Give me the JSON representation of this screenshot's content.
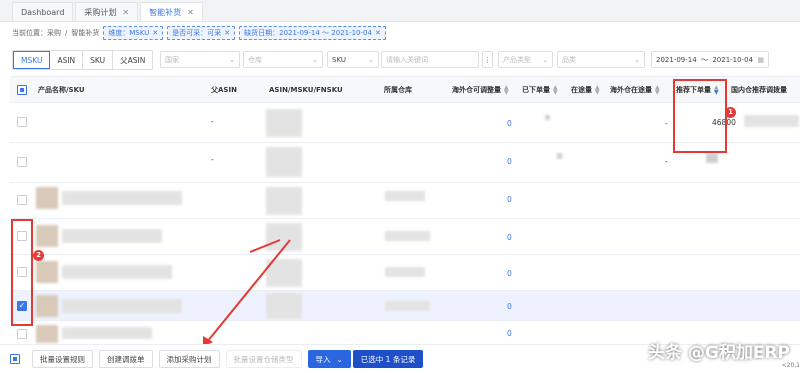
{
  "tabs": [
    {
      "label": "Dashboard",
      "closable": false
    },
    {
      "label": "采购计划",
      "closable": true
    },
    {
      "label": "智能补货",
      "closable": true,
      "active": true
    }
  ],
  "breadcrumb": {
    "prefix": "当前位置：采购",
    "sep": "/",
    "current": "智能补货",
    "chips": [
      "维度：MSKU",
      "是否可采：可采",
      "缺货日期：2021-09-14 ～ 2021-10-04"
    ]
  },
  "toolbar": {
    "segments": [
      "MSKU",
      "ASIN",
      "SKU",
      "父ASIN"
    ],
    "country_placeholder": "国家",
    "warehouse_placeholder": "仓库",
    "search_field": "SKU",
    "search_placeholder": "请输入关键词",
    "more": "⋮",
    "product_type_placeholder": "产品类型",
    "category_placeholder": "品类",
    "date_start": "2021-09-14",
    "date_sep": "～",
    "date_end": "2021-10-04"
  },
  "table": {
    "headers": {
      "product": "产品名称/SKU",
      "parent_asin": "父ASIN",
      "asin": "ASIN/MSKU/FNSKU",
      "warehouse": "所属仓库",
      "overseas_adjust": "海外仓可调整量",
      "ordered": "已下单量",
      "in_transit": "在途量",
      "overseas_transit": "海外仓在途量",
      "recommended": "推荐下单量",
      "domestic": "国内仓推荐调拨量"
    },
    "rows": [
      {
        "parent_asin": "-",
        "overseas_adjust": "0",
        "ordered": "-",
        "in_transit": "-",
        "overseas_transit": "-",
        "recommended": "46800"
      },
      {
        "parent_asin": "-",
        "overseas_adjust": "0",
        "ordered": "-",
        "in_transit": "-",
        "overseas_transit": "-",
        "recommended": ""
      },
      {
        "parent_asin": "",
        "overseas_adjust": "0",
        "ordered": "",
        "in_transit": "",
        "overseas_transit": "",
        "recommended": ""
      },
      {
        "parent_asin": "",
        "overseas_adjust": "0",
        "ordered": "",
        "in_transit": "",
        "overseas_transit": "",
        "recommended": ""
      },
      {
        "parent_asin": "",
        "overseas_adjust": "0",
        "ordered": "",
        "in_transit": "",
        "overseas_transit": "",
        "recommended": ""
      },
      {
        "parent_asin": "",
        "overseas_adjust": "0",
        "ordered": "",
        "in_transit": "",
        "overseas_transit": "",
        "recommended": "",
        "checked": true
      },
      {
        "parent_asin": "",
        "overseas_adjust": "0",
        "ordered": "",
        "in_transit": "",
        "overseas_transit": "",
        "recommended": ""
      }
    ]
  },
  "annotations": {
    "badge1": "1",
    "badge2": "2"
  },
  "footer": {
    "batch_rules": "批量设置规则",
    "create_transfer": "创建调拨单",
    "add_plan": "添加采购计划",
    "batch_warehouse": "批量设置仓储类型",
    "import": "导入",
    "selected": "已选中 1 条记录",
    "pager": "<20,1"
  },
  "watermark": "头条 @G积加ERP",
  "colors": {
    "accent": "#3a76e8",
    "highlight": "#e53935",
    "selected_row": "#eef2ff"
  }
}
